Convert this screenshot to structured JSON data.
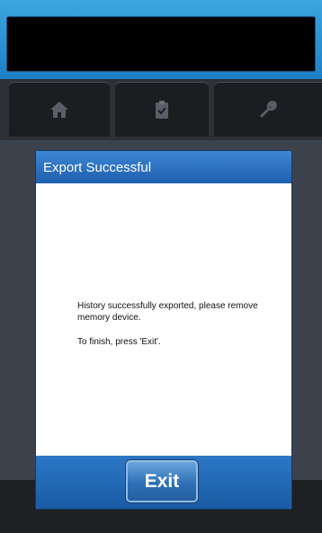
{
  "colors": {
    "accent": "#2b73c2",
    "header_gradient_top": "#3d86d4",
    "frame_blue": "#2e92d4",
    "background": "#3c424b"
  },
  "tabs": [
    {
      "icon": "home-icon"
    },
    {
      "icon": "clipboard-icon"
    },
    {
      "icon": "tools-icon"
    }
  ],
  "dialog": {
    "title": "Export Successful",
    "message_line1": "History successfully exported, please remove memory device.",
    "message_line2": "To finish, press 'Exit'.",
    "exit_label": "Exit"
  }
}
